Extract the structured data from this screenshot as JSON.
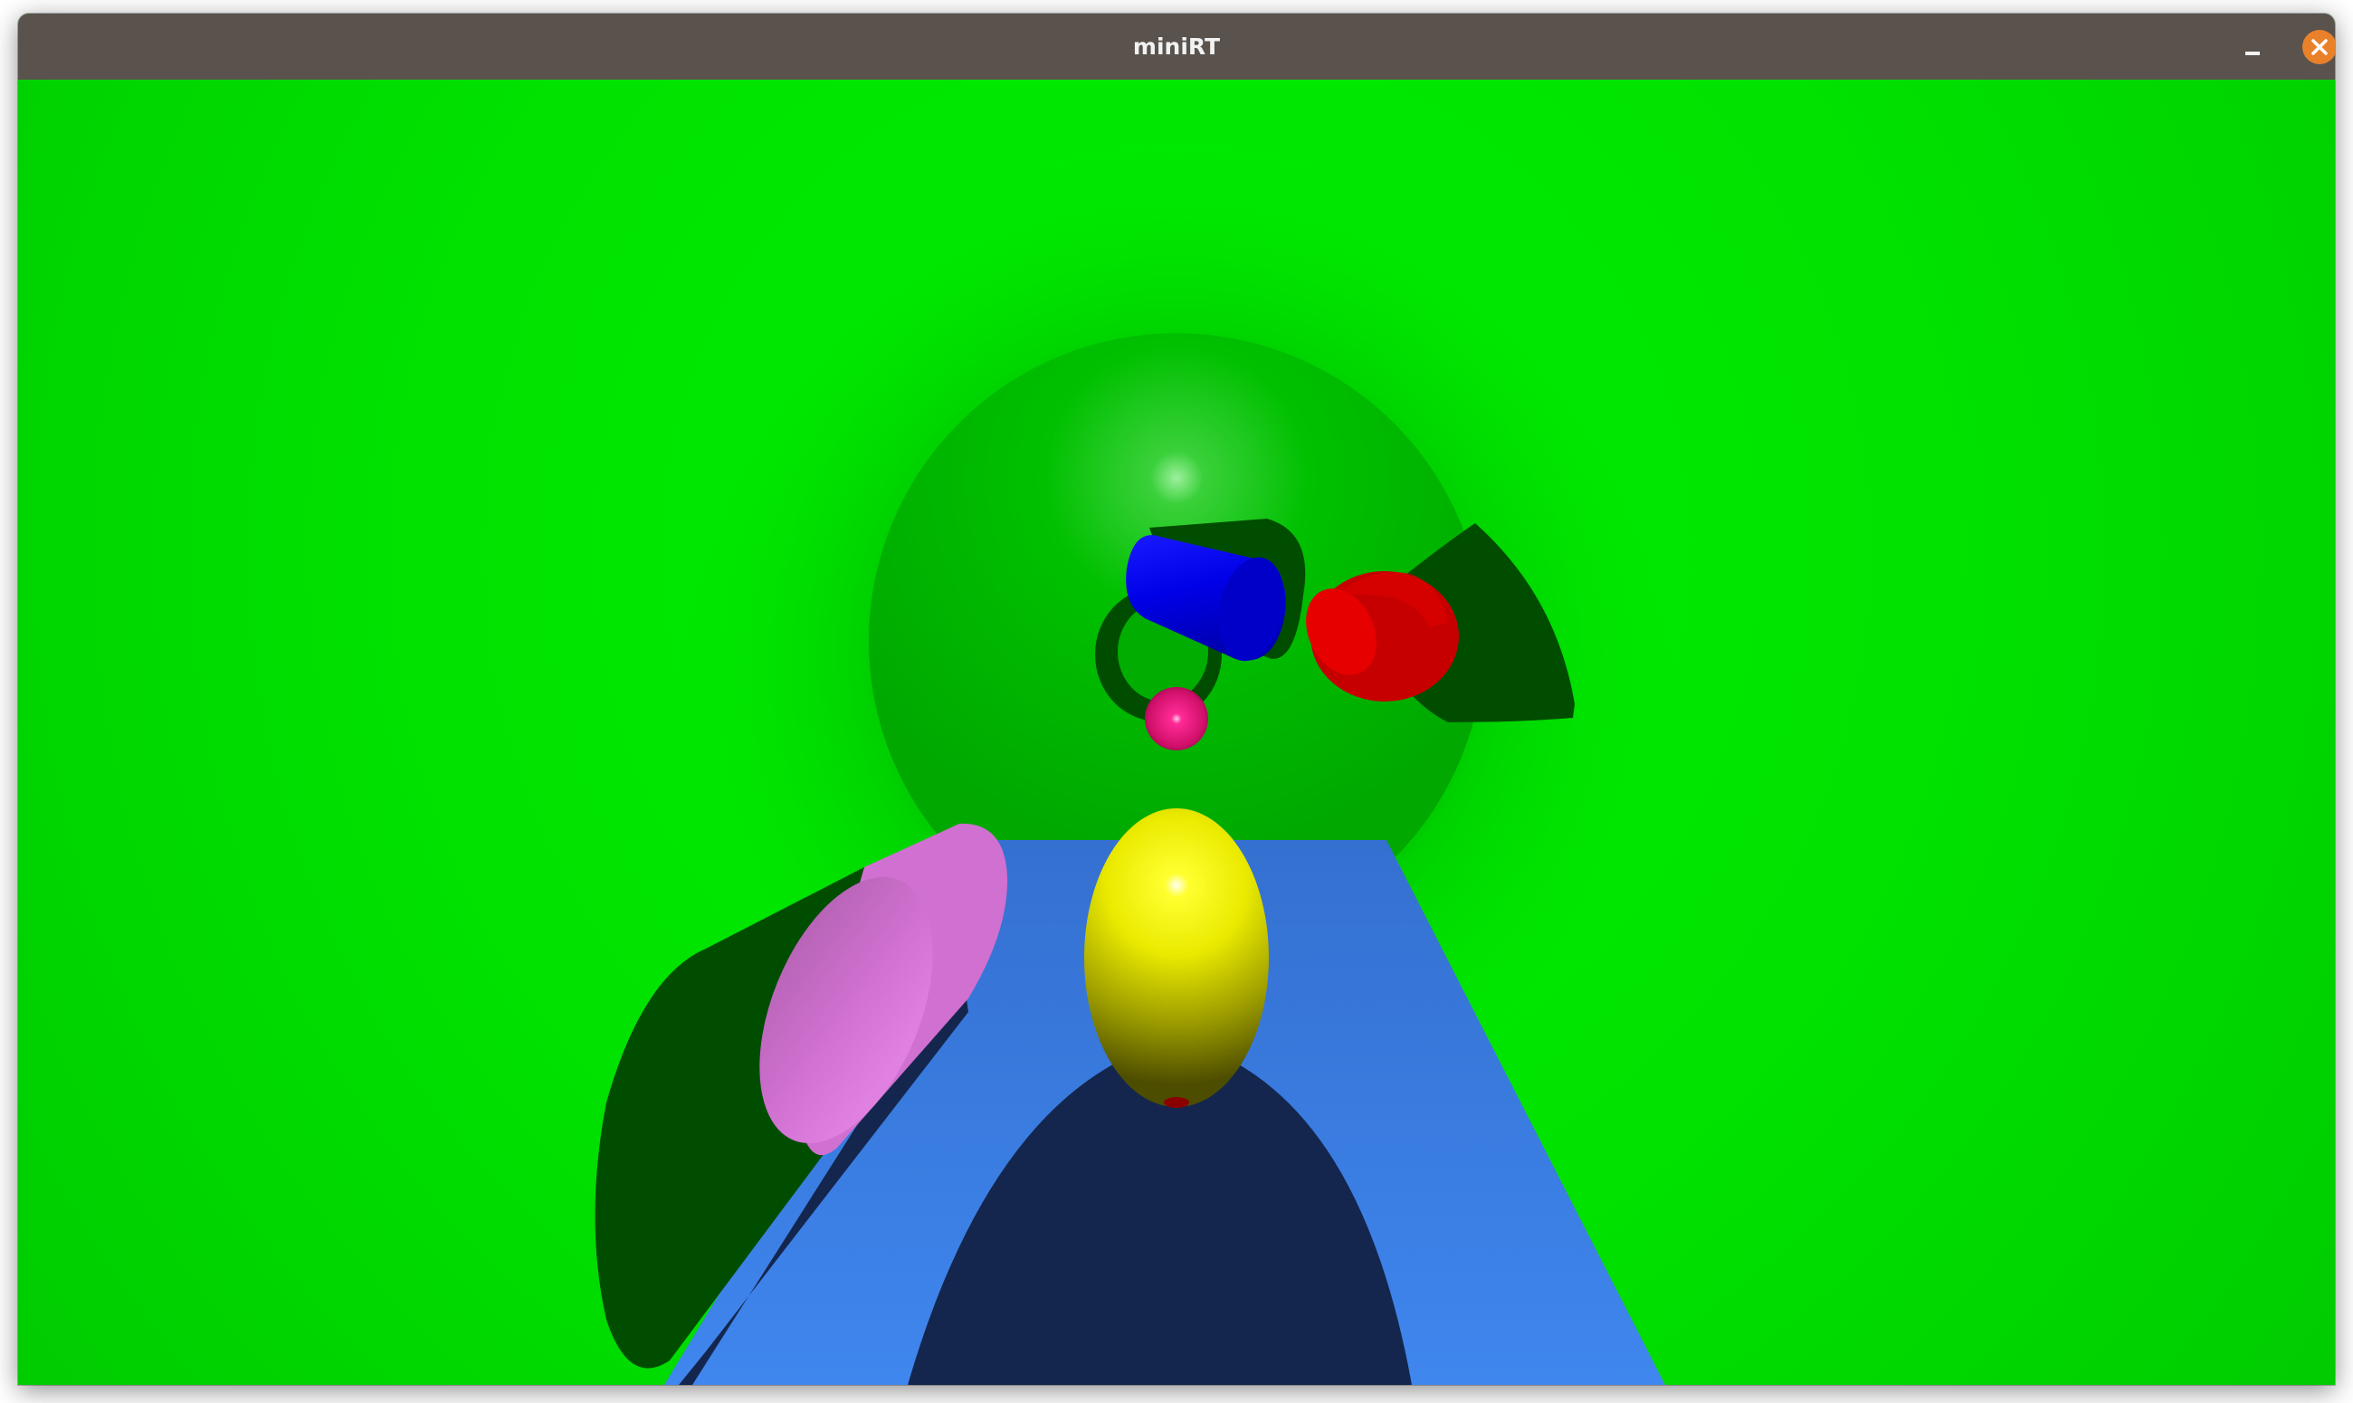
{
  "window": {
    "title": "miniRT"
  },
  "controls": {
    "minimize": "minimize-icon",
    "close": "close-icon"
  },
  "colors": {
    "titlebar": "#5a524d",
    "close_button": "#e9812a",
    "background": "#00e600",
    "floor": "#3d7fe0",
    "floor_shadow": "#14264d",
    "shadow": "#014d00",
    "large_sphere": "#00c200",
    "blue_cylinder": "#0000f0",
    "red_cylinder": "#e00000",
    "pink_cylinder": "#d06cd0",
    "magenta_sphere": "#ff1a8c",
    "yellow_sphere": "#f0f000"
  }
}
